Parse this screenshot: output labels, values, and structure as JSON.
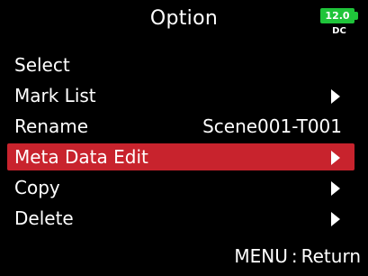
{
  "header": {
    "title": "Option",
    "battery": {
      "voltage": "12.0",
      "source": "DC",
      "color": "#1fc43a"
    }
  },
  "menu": {
    "items": [
      {
        "label": "Select",
        "value": "",
        "has_arrow": false,
        "selected": false
      },
      {
        "label": "Mark List",
        "value": "",
        "has_arrow": true,
        "selected": false
      },
      {
        "label": "Rename",
        "value": "Scene001-T001",
        "has_arrow": false,
        "selected": false
      },
      {
        "label": "Meta Data Edit",
        "value": "",
        "has_arrow": true,
        "selected": true
      },
      {
        "label": "Copy",
        "value": "",
        "has_arrow": true,
        "selected": false
      },
      {
        "label": "Delete",
        "value": "",
        "has_arrow": true,
        "selected": false
      }
    ],
    "highlight_color": "#c8232d"
  },
  "footer": {
    "hint": "MENU : Return"
  }
}
